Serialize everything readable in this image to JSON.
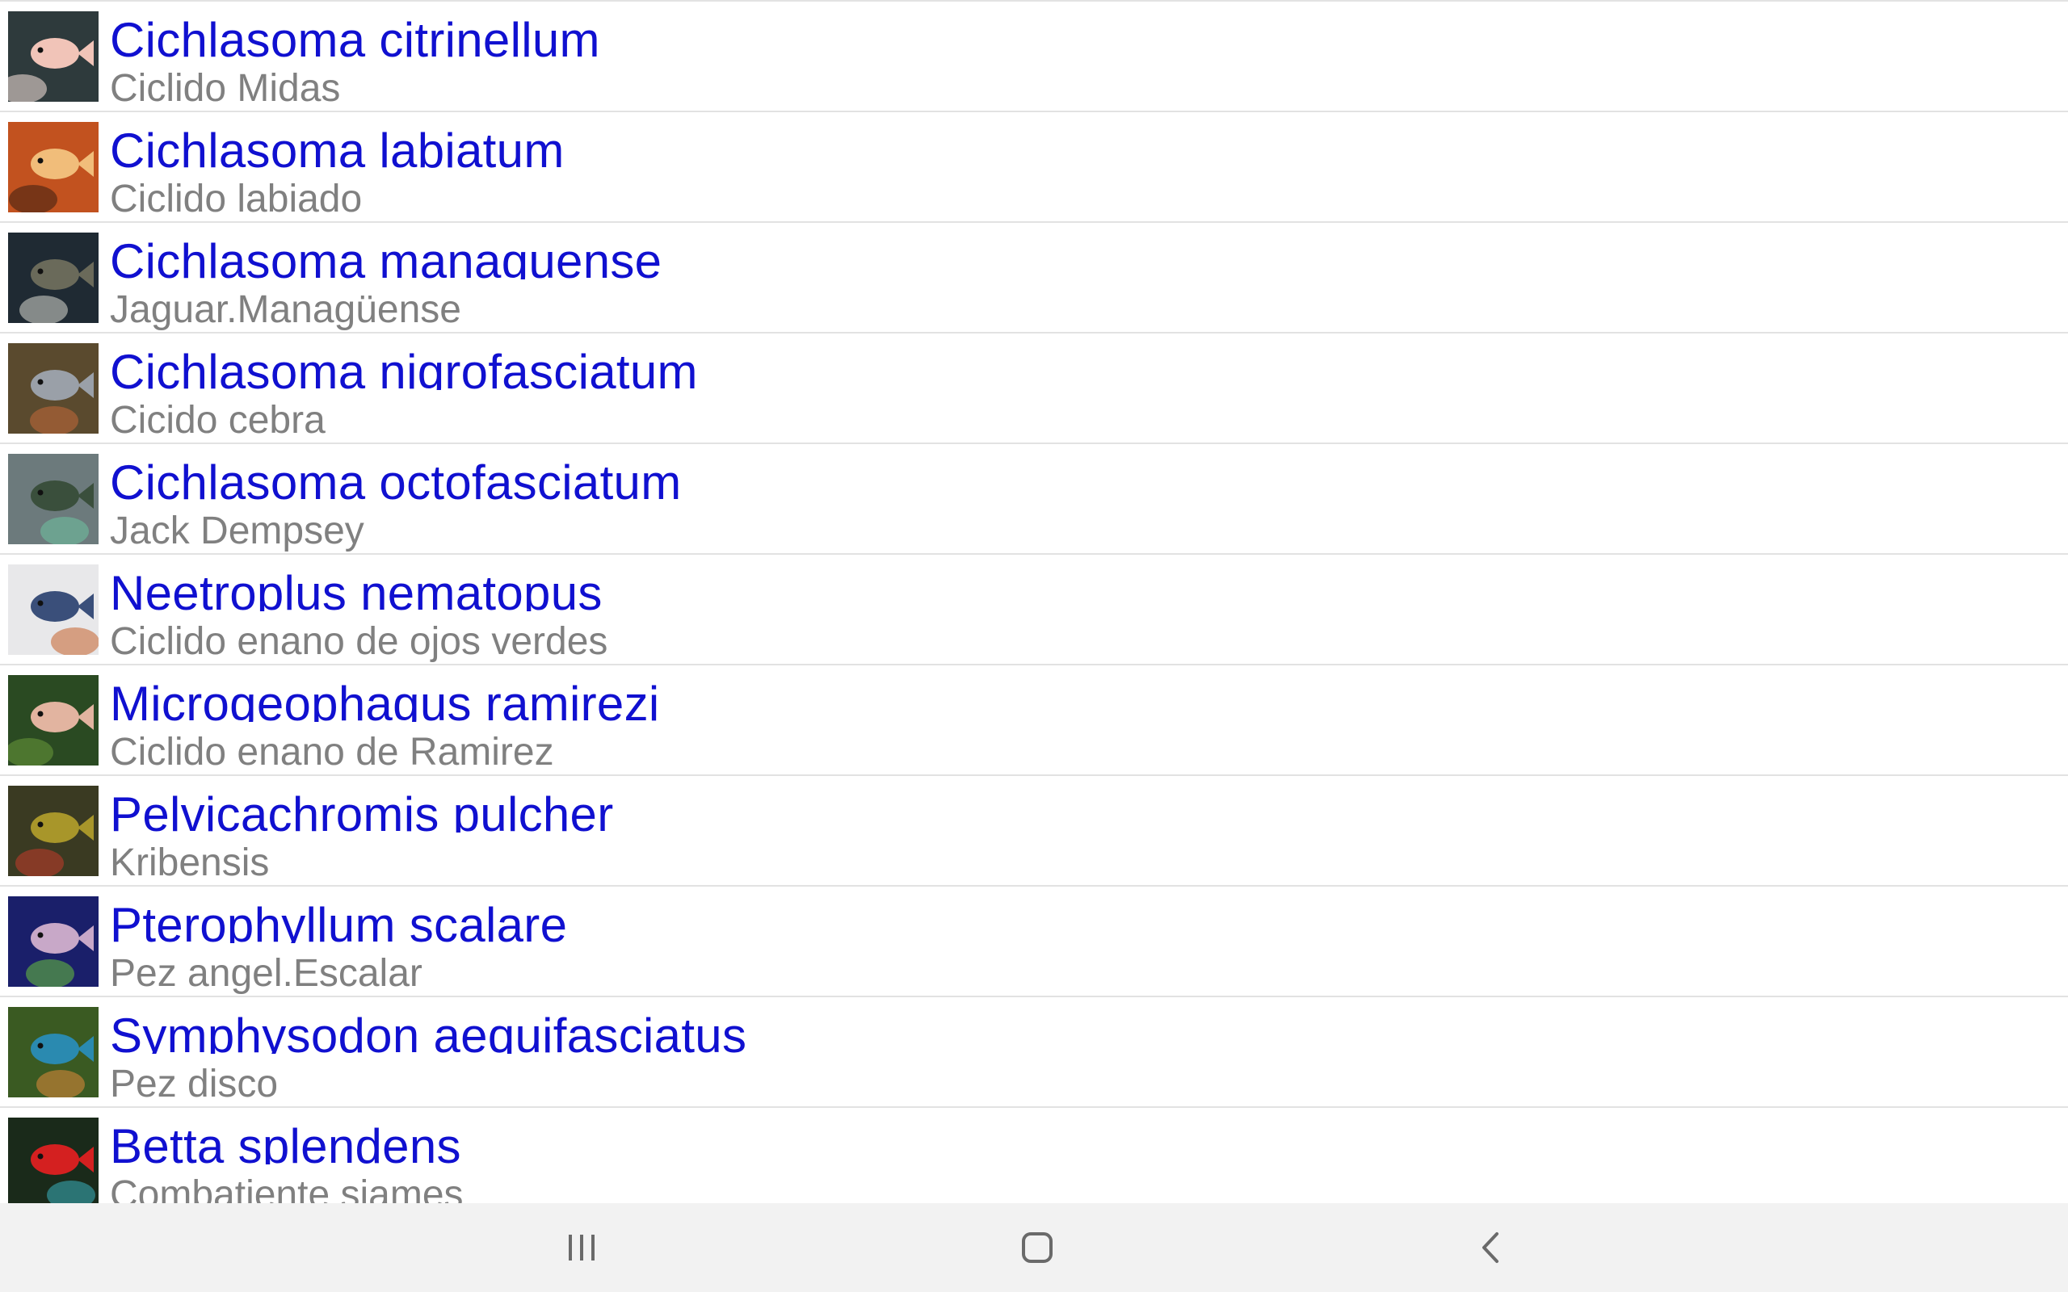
{
  "species": [
    {
      "scientific": "Cichlasoma citrinellum",
      "common": "Ciclido Midas",
      "thumb": {
        "bg": "#2e3a3c",
        "fish": "#f1c4b8",
        "accent": "#fbe5df"
      }
    },
    {
      "scientific": "Cichlasoma labiatum",
      "common": "Ciclido labiado",
      "thumb": {
        "bg": "#c2521f",
        "fish": "#f1bd7a",
        "accent": "#3a1e10"
      }
    },
    {
      "scientific": "Cichlasoma managuense",
      "common": "Jaguar.Managüense",
      "thumb": {
        "bg": "#1f2a33",
        "fish": "#6a6a5a",
        "accent": "#d8d8d0"
      }
    },
    {
      "scientific": "Cichlasoma nigrofasciatum",
      "common": "Cicido cebra",
      "thumb": {
        "bg": "#5a4a2e",
        "fish": "#9aa0a8",
        "accent": "#c46a3a"
      }
    },
    {
      "scientific": "Cichlasoma octofasciatum",
      "common": "Jack Dempsey",
      "thumb": {
        "bg": "#6c7a7c",
        "fish": "#3a4f3c",
        "accent": "#6fc2a0"
      }
    },
    {
      "scientific": "Neetroplus nematopus",
      "common": "Ciclido enano de ojos verdes",
      "thumb": {
        "bg": "#e8e8ea",
        "fish": "#3a4f7a",
        "accent": "#c4602a"
      }
    },
    {
      "scientific": "Microgeophagus ramirezi",
      "common": "Ciclido enano de Ramirez",
      "thumb": {
        "bg": "#2a4a22",
        "fish": "#e2b4a0",
        "accent": "#6a9a3a"
      }
    },
    {
      "scientific": "Pelvicachromis pulcher",
      "common": "Kribensis",
      "thumb": {
        "bg": "#3a3a22",
        "fish": "#a8962a",
        "accent": "#c43a2a"
      }
    },
    {
      "scientific": "Pterophyllum scalare",
      "common": "Pez angel.Escalar",
      "thumb": {
        "bg": "#1a1f6a",
        "fish": "#c8a8c8",
        "accent": "#6ac23a"
      }
    },
    {
      "scientific": "Symphysodon aequifasciatus",
      "common": "Pez disco",
      "thumb": {
        "bg": "#3a5a22",
        "fish": "#2a8ab0",
        "accent": "#e28a3a"
      }
    },
    {
      "scientific": "Betta splendens",
      "common": "Combatiente siames",
      "thumb": {
        "bg": "#1a2a1a",
        "fish": "#d42020",
        "accent": "#3ab0c0"
      }
    }
  ],
  "nav": {
    "recents_icon": "recent-apps-icon",
    "home_icon": "home-icon",
    "back_icon": "back-icon",
    "icon_color": "#6a6a6a"
  }
}
